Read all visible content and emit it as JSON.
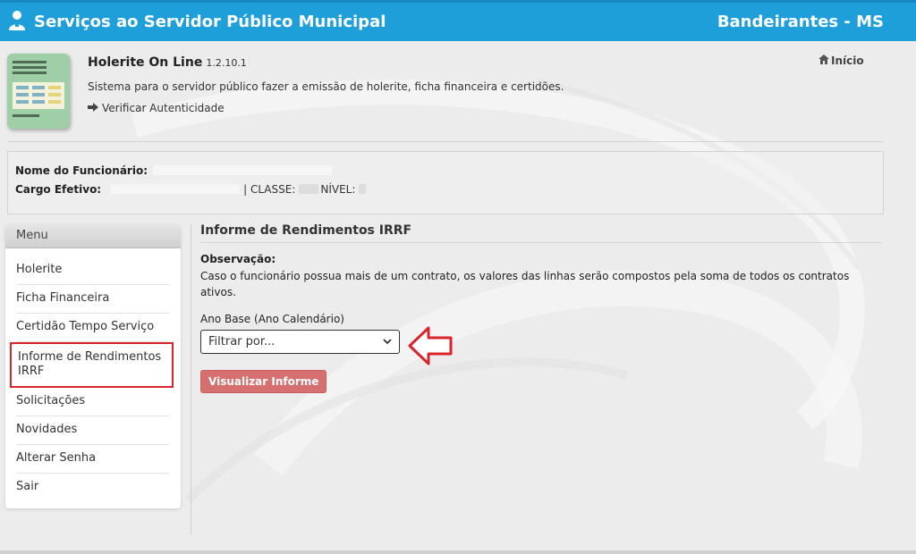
{
  "header": {
    "title": "Serviços ao Servidor Público Municipal",
    "city": "Bandeirantes - MS"
  },
  "app": {
    "name": "Holerite On Line",
    "version": "1.2.10.1",
    "description": "Sistema para o servidor público fazer a emissão de holerite, ficha financeira e certidões.",
    "verify_link": "Verificar Autenticidade",
    "home_link": "Início"
  },
  "employee": {
    "name_label": "Nome do Funcionário:",
    "cargo_label": "Cargo Efetivo:",
    "classe_label": "| CLASSE:",
    "nivel_label": "NÍVEL:"
  },
  "menu": {
    "title": "Menu",
    "items": [
      {
        "label": "Holerite"
      },
      {
        "label": "Ficha Financeira"
      },
      {
        "label": "Certidão Tempo Serviço"
      },
      {
        "label": "Informe de Rendimentos IRRF"
      },
      {
        "label": "Solicitações"
      },
      {
        "label": "Novidades"
      },
      {
        "label": "Alterar Senha"
      },
      {
        "label": "Sair"
      }
    ]
  },
  "main": {
    "title": "Informe de Rendimentos IRRF",
    "obs_label": "Observação:",
    "obs_text": "Caso o funcionário possua mais de um contrato, os valores das linhas serão compostos pela soma de todos os contratos ativos.",
    "ano_label": "Ano Base (Ano Calendário)",
    "select_value": "Filtrar por...",
    "button_label": "Visualizar Informe"
  },
  "colors": {
    "header_bg": "#1e9fd9",
    "button_bg": "#d67070",
    "highlight": "#d9232d"
  }
}
